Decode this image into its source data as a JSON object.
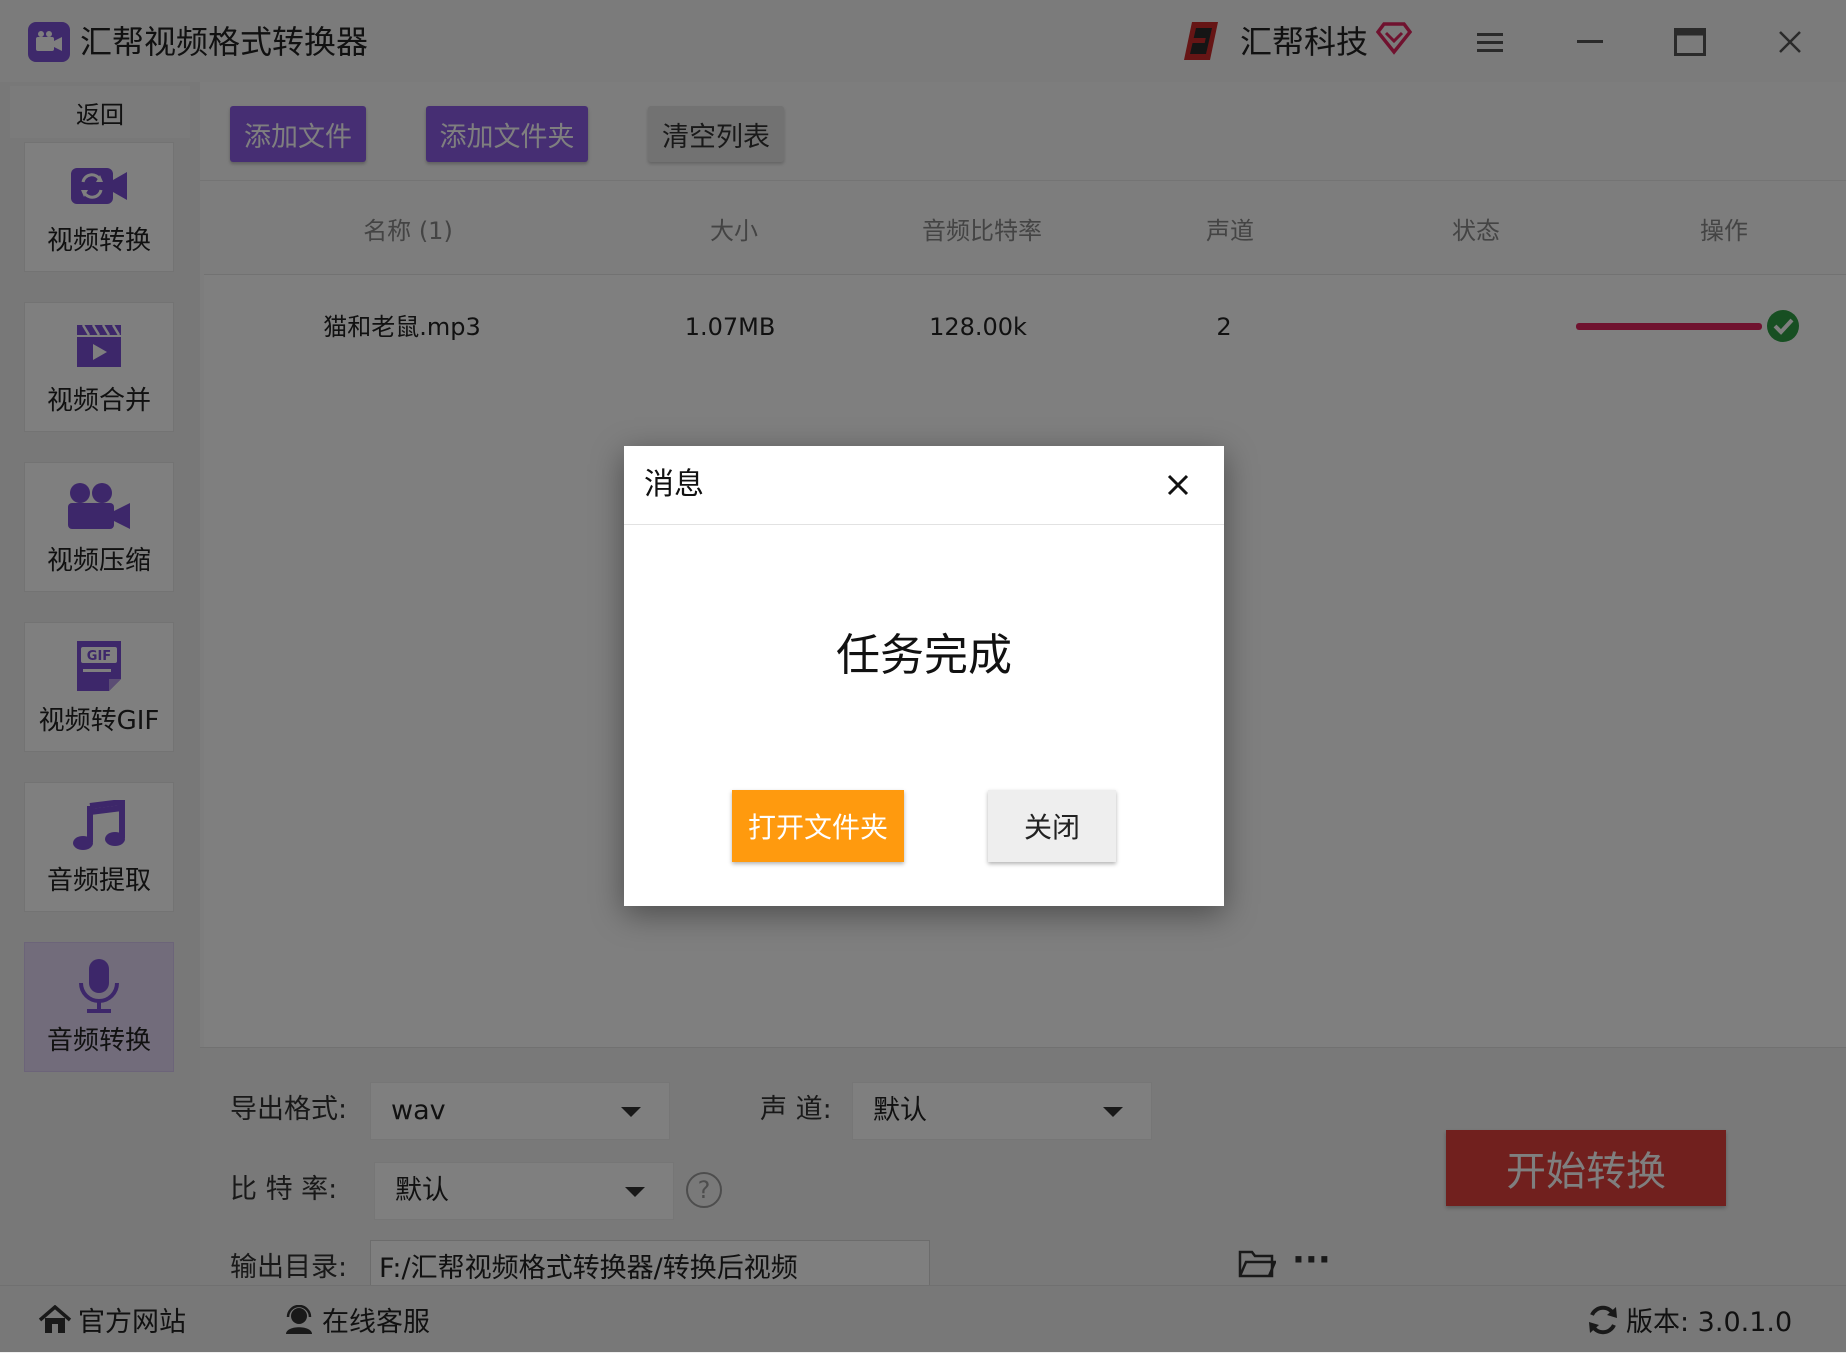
{
  "app": {
    "title": "汇帮视频格式转换器",
    "brand": "汇帮科技"
  },
  "sidebar": {
    "back_label": "返回",
    "items": [
      {
        "label": "视频转换",
        "icon": "video-convert-icon"
      },
      {
        "label": "视频合并",
        "icon": "video-merge-icon"
      },
      {
        "label": "视频压缩",
        "icon": "video-compress-icon"
      },
      {
        "label": "视频转GIF",
        "icon": "gif-icon"
      },
      {
        "label": "音频提取",
        "icon": "music-note-icon"
      },
      {
        "label": "音频转换",
        "icon": "microphone-icon",
        "active": true
      }
    ]
  },
  "toolbar": {
    "add_file": "添加文件",
    "add_folder": "添加文件夹",
    "clear_list": "清空列表"
  },
  "table": {
    "headers": [
      "名称 (1)",
      "大小",
      "音频比特率",
      "声道",
      "状态",
      "操作"
    ],
    "rows": [
      {
        "name": "猫和老鼠.mp3",
        "size": "1.07MB",
        "bitrate": "128.00k",
        "channels": "2",
        "progress": 1.0
      }
    ]
  },
  "settings": {
    "format_label": "导出格式:",
    "format_value": "wav",
    "channel_label": "声 道:",
    "channel_value": "默认",
    "bitrate_label": "比 特 率:",
    "bitrate_value": "默认",
    "help_glyph": "?",
    "output_label": "输出目录:",
    "output_value": "F:/汇帮视频格式转换器/转换后视频",
    "more_glyph": "···",
    "start_label": "开始转换"
  },
  "statusbar": {
    "website": "官方网站",
    "support": "在线客服",
    "version": "版本: 3.0.1.0"
  },
  "dialog": {
    "title": "消息",
    "message": "任务完成",
    "open_folder": "打开文件夹",
    "close": "关闭"
  },
  "colors": {
    "accent": "#8c5ce6",
    "start": "#e3413c",
    "open_folder": "#ff9a0e",
    "progress": "#e0245e",
    "success": "#2e9e44"
  }
}
